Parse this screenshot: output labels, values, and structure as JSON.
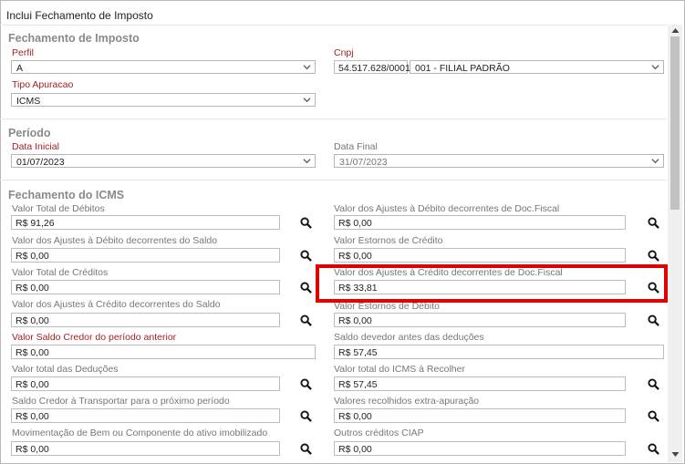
{
  "window": {
    "title": "Inclui Fechamento de Imposto"
  },
  "sections": {
    "fechamento": "Fechamento de Imposto",
    "periodo": "Período",
    "icms": "Fechamento do ICMS"
  },
  "fields": {
    "perfil": {
      "label": "Perfil",
      "value": "A"
    },
    "cnpj": {
      "label": "Cnpj",
      "value": "54.517.628/0001-",
      "filial": "001 - FILIAL PADRÃO"
    },
    "tipo_apuracao": {
      "label": "Tipo Apuracao",
      "value": "ICMS"
    },
    "data_inicial": {
      "label": "Data Inicial",
      "value": "01/07/2023"
    },
    "data_final": {
      "label": "Data Final",
      "value": "31/07/2023"
    }
  },
  "icms": {
    "valor_total_debitos": {
      "label": "Valor Total de Débitos",
      "value": "R$ 91,26"
    },
    "ajustes_debito_doc": {
      "label": "Valor dos Ajustes à Débito decorrentes de Doc.Fiscal",
      "value": "R$ 0,00"
    },
    "ajustes_debito_saldo": {
      "label": "Valor dos Ajustes à Débito decorrentes do Saldo",
      "value": "R$ 0,00"
    },
    "estornos_credito": {
      "label": "Valor Estornos de Crédito",
      "value": "R$ 0,00"
    },
    "valor_total_creditos": {
      "label": "Valor Total de Créditos",
      "value": "R$ 0,00"
    },
    "ajustes_credito_doc": {
      "label": "Valor dos Ajustes à Crédito decorrentes de Doc.Fiscal",
      "value": "R$ 33,81"
    },
    "ajustes_credito_saldo": {
      "label": "Valor dos Ajustes à Crédito decorrentes do Saldo",
      "value": "R$ 0,00"
    },
    "estornos_debito": {
      "label": "Valor Estornos de Débito",
      "value": "R$ 0,00"
    },
    "saldo_credor_anterior": {
      "label": "Valor Saldo Credor do período anterior",
      "value": "R$ 0,00"
    },
    "saldo_devedor": {
      "label": "Saldo devedor antes das deduções",
      "value": "R$ 57,45"
    },
    "total_deducoes": {
      "label": "Valor total das Deduções",
      "value": "R$ 0,00"
    },
    "icms_recolher": {
      "label": "Valor total do ICMS à Recolher",
      "value": "R$ 57,45"
    },
    "saldo_credor_transportar": {
      "label": "Saldo Credor à Transportar para o próximo período",
      "value": "R$ 0,00"
    },
    "recolhidos_extra": {
      "label": "Valores recolhidos extra-apuração",
      "value": "R$ 0,00"
    },
    "movimentacao_bem": {
      "label": "Movimentação de Bem ou Componente do ativo imobilizado",
      "value": "R$ 0,00"
    },
    "outros_creditos_ciap": {
      "label": "Outros créditos CIAP",
      "value": "R$ 0,00"
    }
  },
  "colors": {
    "required_label": "#a31f24",
    "highlight": "#e00000"
  }
}
